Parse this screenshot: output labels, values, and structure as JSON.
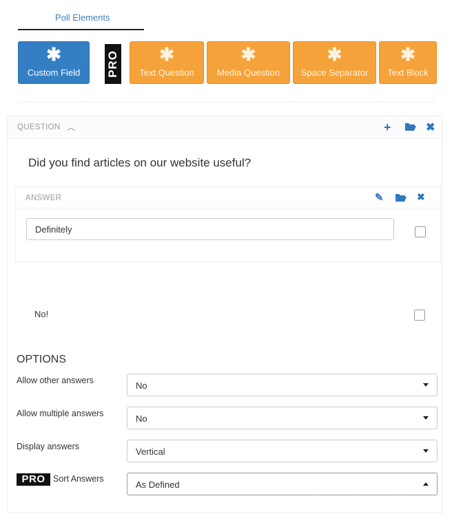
{
  "tabs": {
    "poll_elements": "Poll Elements"
  },
  "elements": [
    {
      "label": "Custom Field",
      "icon": "asterisk-icon"
    },
    {
      "label": "Text Question",
      "icon": "asterisk-icon"
    },
    {
      "label": "Media Question",
      "icon": "asterisk-icon"
    },
    {
      "label": "Space Separator",
      "icon": "asterisk-icon"
    },
    {
      "label": "Text Block",
      "icon": "asterisk-icon"
    }
  ],
  "pro_badge": "PRO",
  "question": {
    "header": "QUESTION",
    "text": "Did you find articles on our website useful?"
  },
  "answer": {
    "header": "ANSWER",
    "value": "Definitely"
  },
  "second_answer": "No!",
  "options": {
    "title": "OPTIONS",
    "allow_other": {
      "label": "Allow other answers",
      "value": "No"
    },
    "allow_multiple": {
      "label": "Allow multiple answers",
      "value": "No"
    },
    "display": {
      "label": "Display answers",
      "value": "Vertical"
    },
    "sort": {
      "label": "Sort Answers",
      "value": "As Defined"
    }
  },
  "colors": {
    "primary": "#347fc4",
    "orange": "#f5a23a",
    "icon_blue": "#2f78c0"
  }
}
